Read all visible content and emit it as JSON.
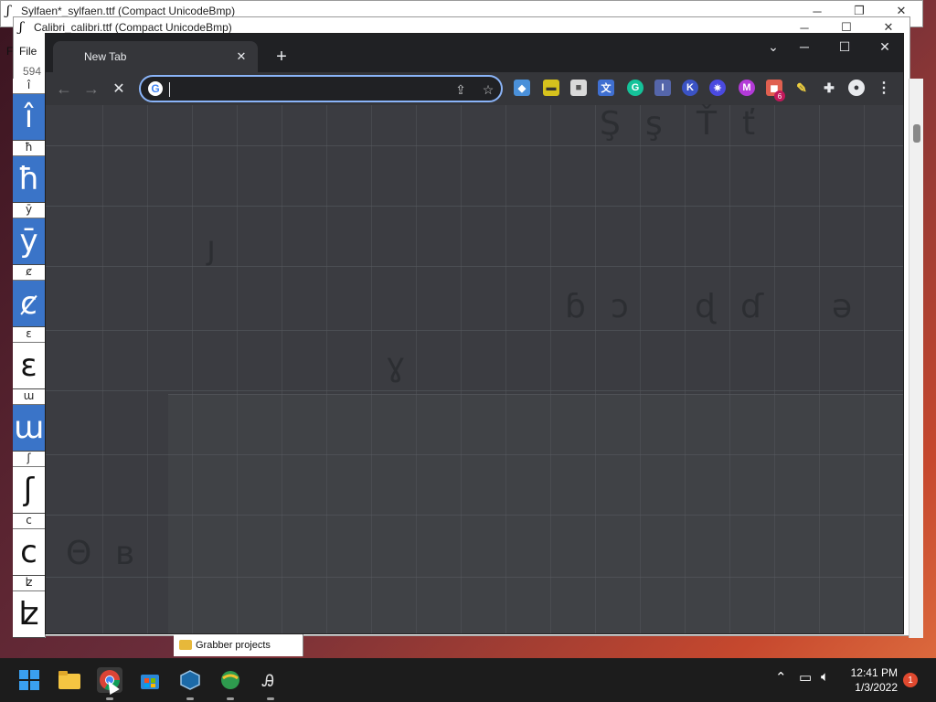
{
  "back_windows": {
    "window1_title": "Sylfaen*_sylfaen.ttf (Compact UnicodeBmp)",
    "window2_title": "Calibri_calibri.ttf (Compact UnicodeBmp)",
    "menu_file": "File",
    "menu_f": "F",
    "index_label": "594",
    "glyph_cells": [
      {
        "small": "î",
        "big": "î",
        "selected": true
      },
      {
        "small": "ħ",
        "big": "ħ",
        "selected": true
      },
      {
        "small": "ȳ",
        "big": "ȳ",
        "selected": true
      },
      {
        "small": "ȼ",
        "big": "ȼ",
        "selected": true
      },
      {
        "small": "ɛ",
        "big": "ɛ",
        "selected": false
      },
      {
        "small": "ɯ",
        "big": "ɯ",
        "selected": true
      },
      {
        "small": "ʃ",
        "big": "ʃ",
        "selected": false
      },
      {
        "small": "ᴄ",
        "big": "ᴄ",
        "selected": false
      },
      {
        "small": "ʫ",
        "big": "ʫ",
        "selected": false
      }
    ]
  },
  "browser": {
    "tab_title": "New Tab",
    "omnibox_value": "",
    "omnibox_placeholder": "",
    "extension_badge": "6"
  },
  "ghost_glyphs": [
    "Ş",
    "ş",
    "Ť",
    "ť",
    "ȷ",
    "ɓ",
    "ɔ",
    "ɖ",
    "ɗ",
    "ə",
    "ɣ",
    "Θ",
    "в"
  ],
  "file_tree": {
    "item": "Grabber projects"
  },
  "taskbar": {
    "time": "12:41 PM",
    "date": "1/3/2022",
    "notification_count": "1"
  },
  "colors": {
    "chrome_frame": "#202124",
    "chrome_toolbar": "#35363a",
    "omnibox_focus": "#8ab4f8",
    "selection_blue": "#3a74c8",
    "taskbar": "#1c1c1c"
  }
}
